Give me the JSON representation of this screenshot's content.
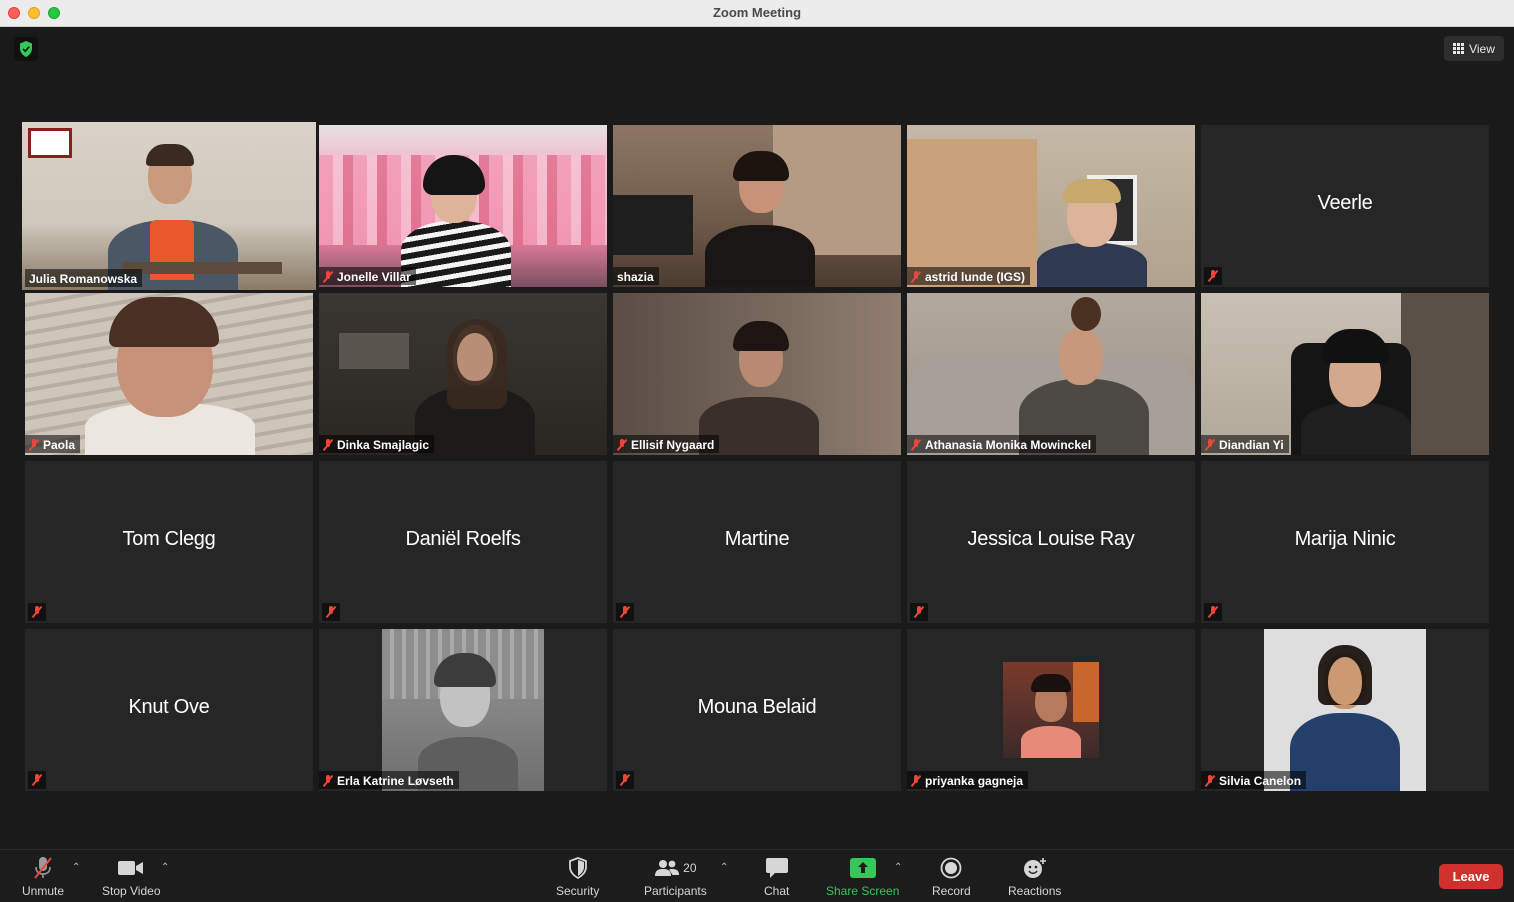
{
  "window": {
    "title": "Zoom Meeting"
  },
  "top": {
    "view_label": "View"
  },
  "tiles": [
    {
      "name": "Julia Romanowska",
      "video": true,
      "active": true,
      "muted": false
    },
    {
      "name": "Jonelle Villar",
      "video": true,
      "muted": true
    },
    {
      "name": "shazia",
      "video": true,
      "muted": false
    },
    {
      "name": "astrid lunde (IGS)",
      "video": true,
      "muted": true
    },
    {
      "name": "Veerle",
      "video": false,
      "muted": true
    },
    {
      "name": "Paola",
      "video": true,
      "muted": true
    },
    {
      "name": "Dinka Smajlagic",
      "video": true,
      "muted": true
    },
    {
      "name": "Ellisif Nygaard",
      "video": true,
      "muted": true
    },
    {
      "name": "Athanasia Monika Mowinckel",
      "video": true,
      "muted": true
    },
    {
      "name": "Diandian Yi",
      "video": true,
      "muted": true
    },
    {
      "name": "Tom Clegg",
      "video": false,
      "muted": true
    },
    {
      "name": "Daniël Roelfs",
      "video": false,
      "muted": true
    },
    {
      "name": "Martine",
      "video": false,
      "muted": true
    },
    {
      "name": "Jessica Louise Ray",
      "video": false,
      "muted": true
    },
    {
      "name": "Marija Ninic",
      "video": false,
      "muted": true
    },
    {
      "name": "Knut Ove",
      "video": false,
      "muted": true
    },
    {
      "name": "Erla Katrine Løvseth",
      "video": false,
      "photo": true,
      "muted": true
    },
    {
      "name": "Mouna Belaid",
      "video": false,
      "muted": true
    },
    {
      "name": "priyanka gagneja",
      "video": false,
      "photo": true,
      "muted": true
    },
    {
      "name": "Silvia Canelon",
      "video": false,
      "photo": true,
      "muted": true
    }
  ],
  "toolbar": {
    "unmute": "Unmute",
    "stop_video": "Stop Video",
    "security": "Security",
    "participants": "Participants",
    "participants_count": "20",
    "chat": "Chat",
    "share_screen": "Share Screen",
    "record": "Record",
    "reactions": "Reactions",
    "leave": "Leave"
  },
  "colors": {
    "active_speaker": "#e7f07a",
    "leave": "#d0312d",
    "share": "#34c759"
  },
  "icons": [
    "shield-icon",
    "grid-icon",
    "muted-mic-icon",
    "camera-icon",
    "security-shield-icon",
    "participants-icon",
    "chat-bubble-icon",
    "share-screen-icon",
    "record-icon",
    "reactions-icon",
    "caret-up-icon"
  ]
}
